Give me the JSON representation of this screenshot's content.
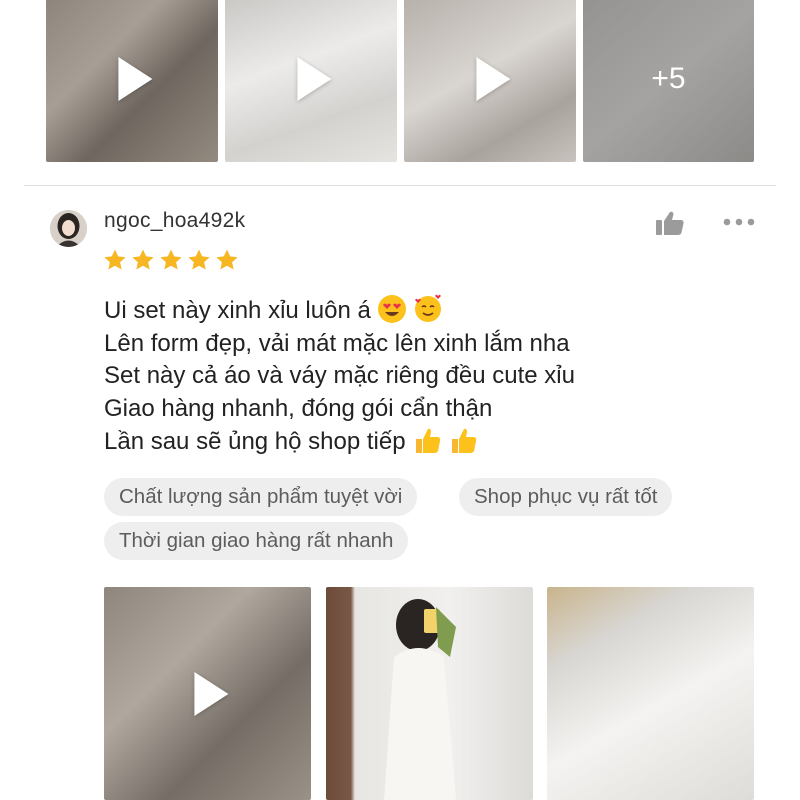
{
  "top_gallery": {
    "thumbnails": [
      {
        "kind": "video",
        "icon": "play-icon"
      },
      {
        "kind": "video",
        "icon": "play-icon"
      },
      {
        "kind": "video",
        "icon": "play-icon"
      },
      {
        "kind": "image",
        "more_label": "+5"
      }
    ]
  },
  "review": {
    "username": "ngoc_hoa492k",
    "rating": 5,
    "rating_max": 5,
    "lines": [
      "Ui set này xinh xỉu luôn á",
      "Lên form đẹp, vải mát mặc lên xinh lắm nha",
      "Set này cả áo và váy mặc riêng đều cute xỉu",
      "Giao hàng nhanh, đóng gói cẩn thận",
      "Lần sau sẽ ủng hộ shop tiếp"
    ],
    "tags": [
      "Chất lượng sản phẩm tuyệt vời",
      "Shop phục vụ rất tốt",
      "Thời gian giao hàng rất nhanh"
    ],
    "media": [
      {
        "kind": "video",
        "icon": "play-icon"
      },
      {
        "kind": "image"
      },
      {
        "kind": "image"
      }
    ]
  },
  "colors": {
    "star": "#f6b722",
    "tag_bg": "#eeeeee",
    "tag_text": "#5c5c5c",
    "divider": "#e2e2e2",
    "icon_gray": "#9b9b9b"
  }
}
